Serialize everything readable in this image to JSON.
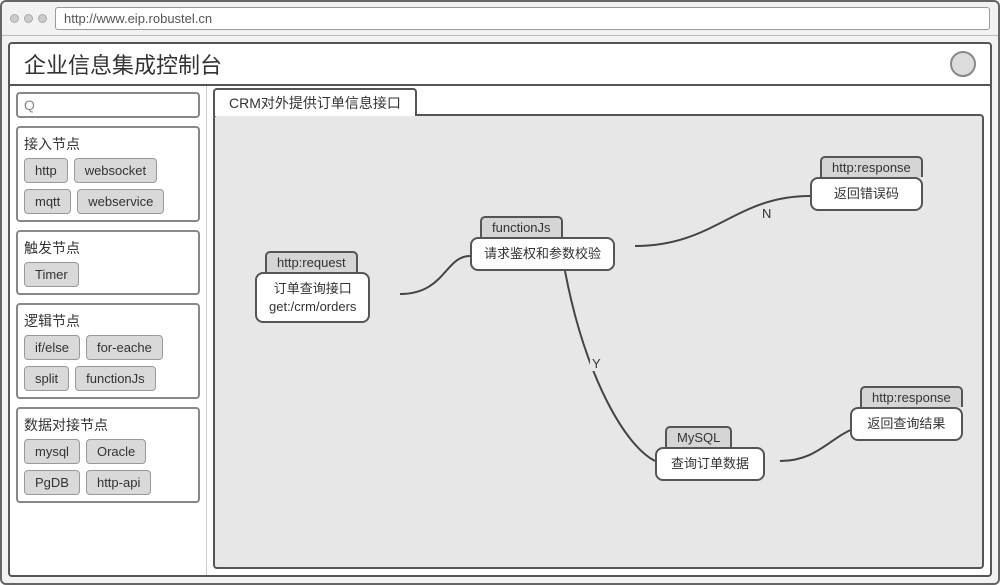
{
  "browser": {
    "url": "http://www.eip.robustel.cn"
  },
  "app": {
    "title": "企业信息集成控制台"
  },
  "sidebar": {
    "search_placeholder": "Q",
    "groups": [
      {
        "title": "接入节点",
        "items": [
          "http",
          "websocket",
          "mqtt",
          "webservice"
        ]
      },
      {
        "title": "触发节点",
        "items": [
          "Timer"
        ]
      },
      {
        "title": "逻辑节点",
        "items": [
          "if/else",
          "for-eache",
          "split",
          "functionJs"
        ]
      },
      {
        "title": "数据对接节点",
        "items": [
          "mysql",
          "Oracle",
          "PgDB",
          "http-api"
        ]
      }
    ]
  },
  "tabs": [
    {
      "label": "CRM对外提供订单信息接口",
      "active": true
    }
  ],
  "flow": {
    "nodes": {
      "n1": {
        "tag": "http:request",
        "body": "订单查询接口\nget:/crm/orders"
      },
      "n2": {
        "tag": "functionJs",
        "body": "请求鉴权和参数校验"
      },
      "n3": {
        "tag": "http:response",
        "body": "返回错误码"
      },
      "n4": {
        "tag": "MySQL",
        "body": "查询订单数据"
      },
      "n5": {
        "tag": "http:response",
        "body": "返回查询结果"
      }
    },
    "edges": {
      "e1": {
        "from": "n1",
        "to": "n2",
        "label": ""
      },
      "e2": {
        "from": "n2",
        "to": "n3",
        "label": "N"
      },
      "e3": {
        "from": "n2",
        "to": "n4",
        "label": "Y"
      },
      "e4": {
        "from": "n4",
        "to": "n5",
        "label": ""
      }
    }
  }
}
